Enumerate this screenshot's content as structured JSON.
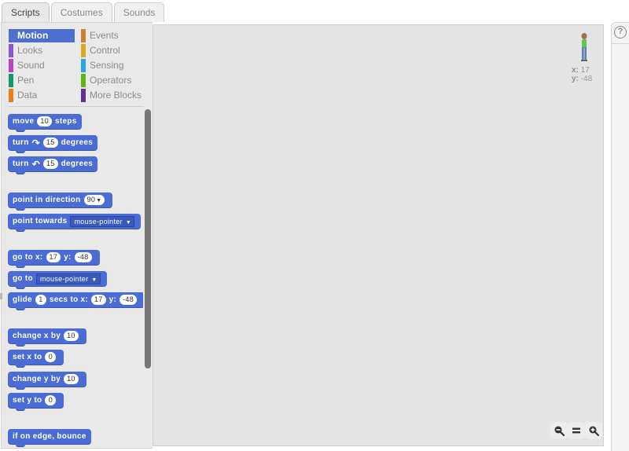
{
  "tabs": [
    {
      "label": "Scripts",
      "active": true
    },
    {
      "label": "Costumes",
      "active": false
    },
    {
      "label": "Sounds",
      "active": false
    }
  ],
  "categories": [
    {
      "label": "Motion",
      "color": "#4a6cd4",
      "selected": true
    },
    {
      "label": "Looks",
      "color": "#8a55d7"
    },
    {
      "label": "Sound",
      "color": "#bb42c3"
    },
    {
      "label": "Pen",
      "color": "#0e9a6c"
    },
    {
      "label": "Data",
      "color": "#ee7d16"
    },
    {
      "label": "Events",
      "color": "#c88330"
    },
    {
      "label": "Control",
      "color": "#e1a91a"
    },
    {
      "label": "Sensing",
      "color": "#2ca5e2"
    },
    {
      "label": "Operators",
      "color": "#5cb712"
    },
    {
      "label": "More Blocks",
      "color": "#632d99"
    }
  ],
  "blocks": {
    "move": {
      "w1": "move",
      "v": "10",
      "w2": "steps"
    },
    "turn_right": {
      "w1": "turn",
      "icon": "rotate-clockwise",
      "v": "15",
      "w2": "degrees"
    },
    "turn_left": {
      "w1": "turn",
      "icon": "rotate-counterclockwise",
      "v": "15",
      "w2": "degrees"
    },
    "point_dir": {
      "w1": "point in direction",
      "v": "90"
    },
    "point_towards": {
      "w1": "point towards",
      "v": "mouse-pointer"
    },
    "goto_xy": {
      "w1": "go to x:",
      "x": "17",
      "w2": "y:",
      "y": "-48"
    },
    "goto": {
      "w1": "go to",
      "v": "mouse-pointer"
    },
    "glide": {
      "w1": "glide",
      "secs": "1",
      "w2": "secs to x:",
      "x": "17",
      "w3": "y:",
      "y": "-48"
    },
    "change_x": {
      "w1": "change x by",
      "v": "10"
    },
    "set_x": {
      "w1": "set x to",
      "v": "0"
    },
    "change_y": {
      "w1": "change y by",
      "v": "10"
    },
    "set_y": {
      "w1": "set y to",
      "v": "0"
    },
    "bounce": {
      "w1": "if on edge, bounce"
    }
  },
  "sprite_info": {
    "x_label": "x:",
    "x": "17",
    "y_label": "y:",
    "y": "-48"
  },
  "zoom": {
    "out": "zoom-out",
    "reset": "=",
    "in": "zoom-in"
  },
  "help": {
    "label": "?"
  }
}
